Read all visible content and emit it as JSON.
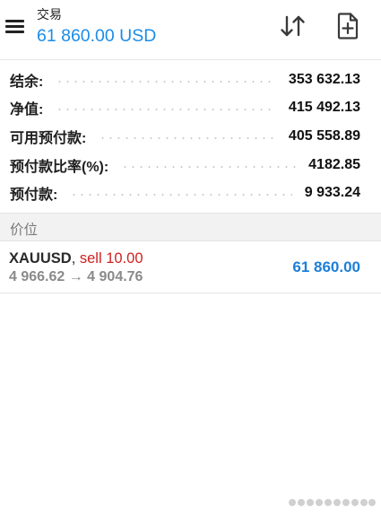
{
  "header": {
    "title": "交易",
    "balance": "61 860.00 USD"
  },
  "summary": {
    "rows": [
      {
        "label": "结余:",
        "value": "353 632.13"
      },
      {
        "label": "净值:",
        "value": "415 492.13"
      },
      {
        "label": "可用预付款:",
        "value": "405 558.89"
      },
      {
        "label": "预付款比率(%):",
        "value": "4182.85"
      },
      {
        "label": "预付款:",
        "value": "9 933.24"
      }
    ]
  },
  "section": {
    "price_label": "价位"
  },
  "position": {
    "symbol": "XAUUSD",
    "separator": ", ",
    "type": "sell 10.00",
    "price_change": "4 966.62 → 4 904.76",
    "profit": "61 860.00"
  },
  "colors": {
    "accent": "#1c8ce8",
    "sell": "#d11f1f",
    "profit": "#1c7fd8"
  },
  "icons": {
    "menu": "menu-icon",
    "sort": "sort-arrows-icon",
    "new_order": "new-document-icon"
  }
}
